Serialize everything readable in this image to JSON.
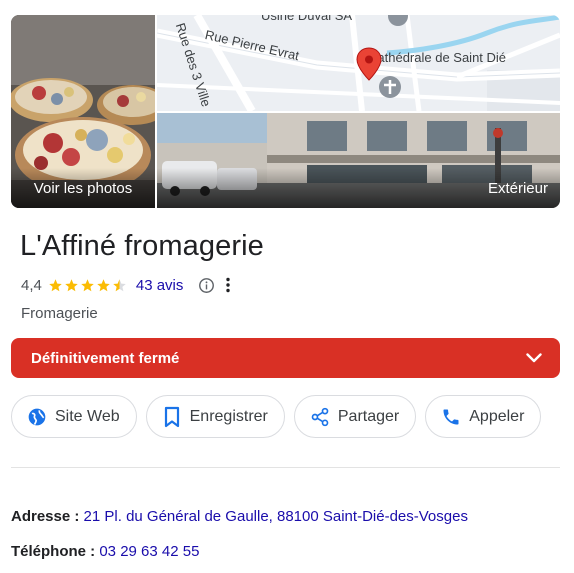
{
  "media": {
    "photos_caption": "Voir les photos",
    "exterior_caption": "Extérieur",
    "map": {
      "streets": [
        "Rue Pierre Evrat",
        "Rue des 3 Ville"
      ],
      "places": [
        "Usine Duval SA",
        "Cathédrale de Saint Dié"
      ]
    }
  },
  "business": {
    "name": "L'Affiné fromagerie",
    "rating": "4,4",
    "rating_numeric": 4.4,
    "reviews": "43 avis",
    "category": "Fromagerie"
  },
  "status_banner": {
    "label": "Définitivement fermé",
    "color": "#d93025"
  },
  "actions": [
    {
      "label": "Site Web",
      "icon": "globe-icon"
    },
    {
      "label": "Enregistrer",
      "icon": "bookmark-icon"
    },
    {
      "label": "Partager",
      "icon": "share-icon"
    },
    {
      "label": "Appeler",
      "icon": "phone-icon"
    }
  ],
  "info": {
    "address_label": "Adresse :",
    "address_value": "21 Pl. du Général de Gaulle, 88100 Saint-Dié-des-Vosges",
    "phone_label": "Téléphone :",
    "phone_value": "03 29 63 42 55"
  },
  "colors": {
    "accent_blue": "#1a73e8",
    "link_blue": "#1a0dab",
    "star_gold": "#fbbc04",
    "map_pin": "#ea4335"
  }
}
